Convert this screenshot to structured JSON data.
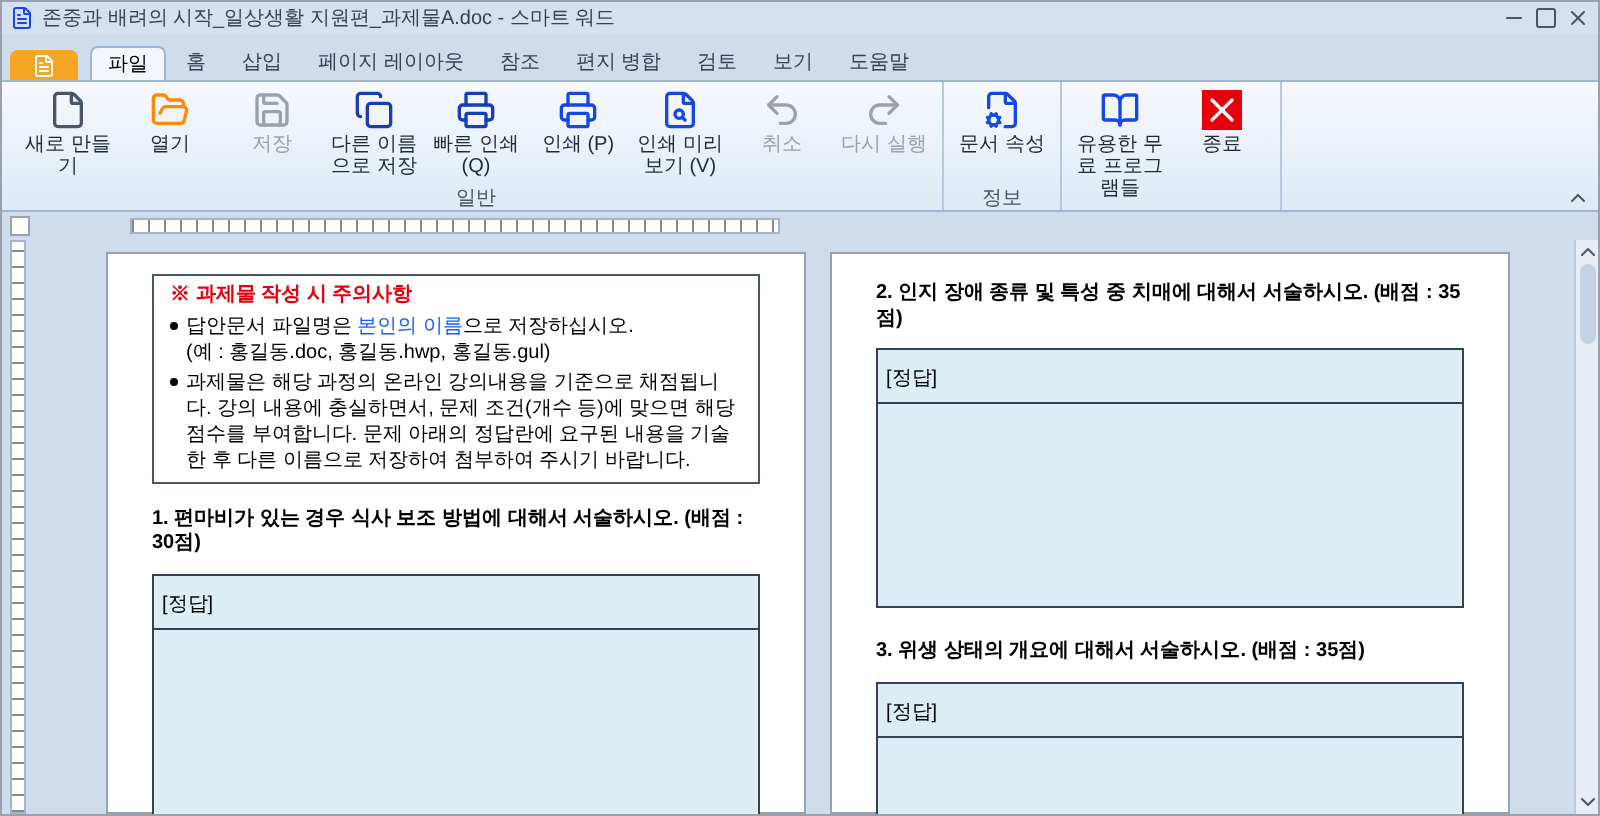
{
  "window": {
    "title": "존중과 배려의 시작_일상생활 지원편_과제물A.doc - 스마트 워드"
  },
  "tabs": [
    {
      "label": "파일",
      "selected": true
    },
    {
      "label": "홈",
      "selected": false
    },
    {
      "label": "삽입",
      "selected": false
    },
    {
      "label": "페이지 레이아웃",
      "selected": false
    },
    {
      "label": "참조",
      "selected": false
    },
    {
      "label": "편지 병합",
      "selected": false
    },
    {
      "label": "검토",
      "selected": false
    },
    {
      "label": "보기",
      "selected": false
    },
    {
      "label": "도움말",
      "selected": false
    }
  ],
  "ribbon_groups": [
    {
      "label": "일반",
      "buttons": [
        {
          "label": "새로 만들기",
          "disabled": false
        },
        {
          "label": "열기",
          "disabled": false
        },
        {
          "label": "저장",
          "disabled": true
        },
        {
          "label": "다른 이름으로 저장",
          "disabled": false
        },
        {
          "label": "빠른 인쇄 (Q)",
          "disabled": false
        },
        {
          "label": "인쇄 (P)",
          "disabled": false
        },
        {
          "label": "인쇄 미리보기 (V)",
          "disabled": false
        },
        {
          "label": "취소",
          "disabled": true
        },
        {
          "label": "다시 실행",
          "disabled": true
        }
      ]
    },
    {
      "label": "정보",
      "buttons": [
        {
          "label": "문서 속성",
          "disabled": false
        }
      ]
    },
    {
      "buttons": [
        {
          "label": "유용한 무료 프로그램들",
          "disabled": false
        },
        {
          "label": "종료",
          "disabled": false
        }
      ]
    }
  ],
  "notice": {
    "title": "※ 과제물 작성 시 주의사항",
    "items": [
      {
        "parts": [
          {
            "text": "답안문서 파일명은 ",
            "highlight": false
          },
          {
            "text": "본인의 이름",
            "highlight": true
          },
          {
            "text": "으로 저장하십시오.",
            "highlight": false
          }
        ],
        "note": "(예 : 홍길동.doc, 홍길동.hwp, 홍길동.gul)"
      },
      {
        "parts": [
          {
            "text": "과제물은 해당 과정의 온라인 강의내용을 기준으로 채점됩니다. 강의 내용에 충실하면서, 문제 조건(개수 등)에 맞으면 해당 점수를 부여합니다. 문제 아래의 정답란에 요구된 내용을 기술한 후 다른 이름으로 저장하여 첨부하여 주시기 바랍니다.",
            "highlight": false
          }
        ]
      }
    ]
  },
  "pages": [
    {
      "questions": [
        {
          "text": "1. 편마비가 있는 경우 식사 보조 방법에 대해서 서술하시오. (배점 : 30점)",
          "answer_label": "[정답]"
        }
      ]
    },
    {
      "questions": [
        {
          "text": "2. 인지 장애 종류 및 특성 중 치매에 대해서 서술하시오. (배점 : 35점)",
          "answer_label": "[정답]"
        },
        {
          "text": "3. 위생 상태의 개요에 대해서 서술하시오. (배점 : 35점)",
          "answer_label": "[정답]"
        }
      ]
    }
  ]
}
